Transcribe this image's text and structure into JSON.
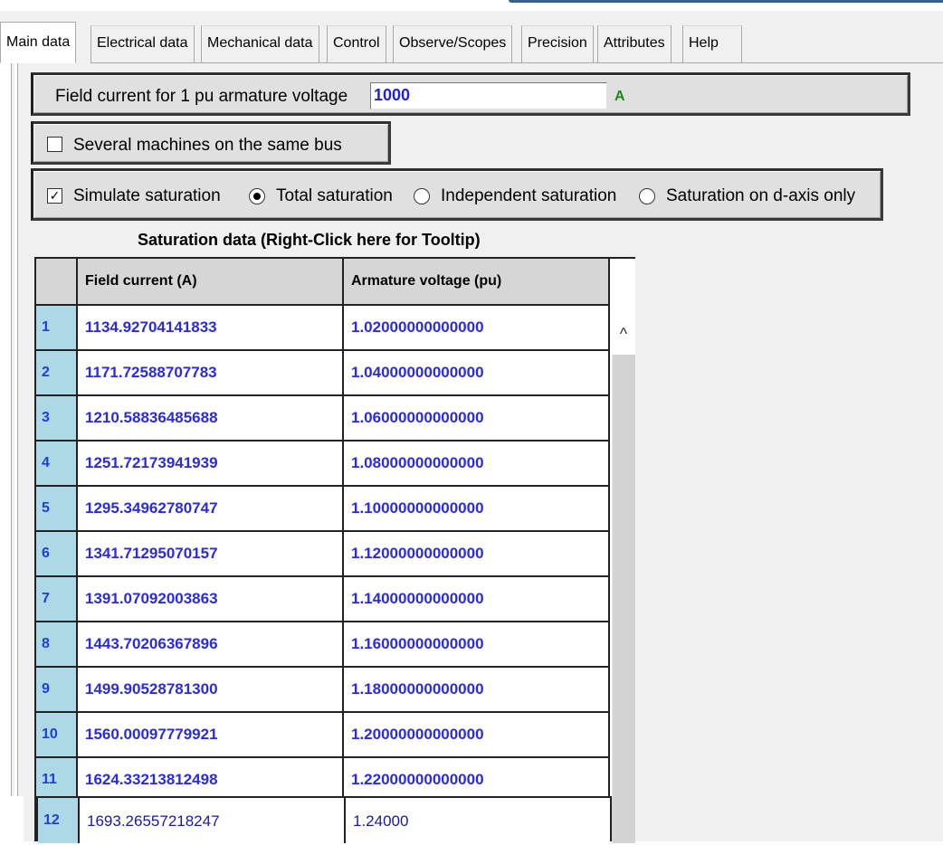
{
  "tabs": [
    {
      "label": "Main data",
      "active": true
    },
    {
      "label": "Electrical data"
    },
    {
      "label": "Mechanical data"
    },
    {
      "label": "Control"
    },
    {
      "label": "Observe/Scopes"
    },
    {
      "label": "Precision"
    },
    {
      "label": "Attributes"
    },
    {
      "label": "Help"
    }
  ],
  "field_current": {
    "label": "Field current for 1 pu armature voltage",
    "value": "1000",
    "unit": "A"
  },
  "several_machines": {
    "label": "Several machines on the same bus",
    "checked": false,
    "check_glyph": ""
  },
  "saturation": {
    "simulate_label": "Simulate saturation",
    "simulate_checked": true,
    "check_glyph": "✓",
    "options": [
      {
        "label": "Total saturation",
        "selected": true
      },
      {
        "label": "Independent saturation",
        "selected": false
      },
      {
        "label": "Saturation on d-axis only",
        "selected": false
      }
    ]
  },
  "table": {
    "title": "Saturation data (Right-Click here for Tooltip)",
    "columns": [
      "Field current (A)",
      "Armature voltage (pu)"
    ],
    "rows": [
      {
        "num": "1",
        "field": "1134.92704141833",
        "voltage": "1.02000000000000"
      },
      {
        "num": "2",
        "field": "1171.72588707783",
        "voltage": "1.04000000000000"
      },
      {
        "num": "3",
        "field": "1210.58836485688",
        "voltage": "1.06000000000000"
      },
      {
        "num": "4",
        "field": "1251.72173941939",
        "voltage": "1.08000000000000"
      },
      {
        "num": "5",
        "field": "1295.34962780747",
        "voltage": "1.10000000000000"
      },
      {
        "num": "6",
        "field": "1341.71295070157",
        "voltage": "1.12000000000000"
      },
      {
        "num": "7",
        "field": "1391.07092003863",
        "voltage": "1.14000000000000"
      },
      {
        "num": "8",
        "field": "1443.70206367896",
        "voltage": "1.16000000000000"
      },
      {
        "num": "9",
        "field": "1499.90528781300",
        "voltage": "1.18000000000000"
      },
      {
        "num": "10",
        "field": "1560.00097779921",
        "voltage": "1.20000000000000"
      },
      {
        "num": "11",
        "field": "1624.33213812498",
        "voltage": "1.22000000000000"
      }
    ],
    "editing_row": {
      "num": "12",
      "field": "1693.26557218247",
      "voltage": "1.24000"
    },
    "scroll_up_glyph": "^"
  }
}
